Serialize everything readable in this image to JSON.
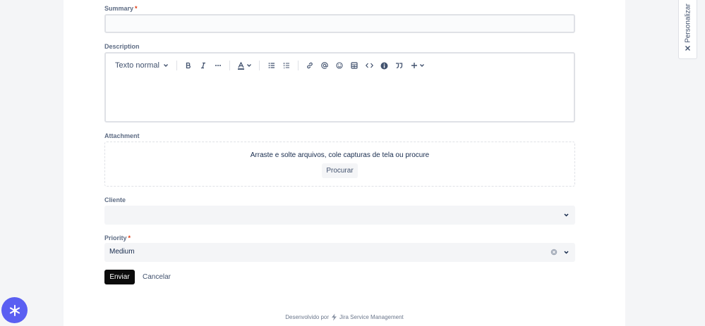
{
  "form": {
    "summary": {
      "label": "Summary",
      "required_mark": "*",
      "value": ""
    },
    "description": {
      "label": "Description",
      "toolbar": {
        "text_style": "Texto normal",
        "buttons": [
          "bold-icon",
          "italic-icon",
          "more-icon",
          "text-color-icon",
          "bullet-list-icon",
          "numbered-list-icon",
          "link-icon",
          "mention-icon",
          "emoji-icon",
          "table-icon",
          "code-icon",
          "info-icon",
          "quote-icon",
          "insert-plus-icon"
        ]
      },
      "value": ""
    },
    "attachment": {
      "label": "Attachment",
      "drop_text": "Arraste e solte arquivos, cole capturas de tela ou procure",
      "browse_label": "Procurar"
    },
    "cliente": {
      "label": "Cliente",
      "value": ""
    },
    "priority": {
      "label": "Priority",
      "required_mark": "*",
      "value": "Medium"
    },
    "submit_label": "Enviar",
    "cancel_label": "Cancelar"
  },
  "footer": {
    "prefix": "Desenvolvido por",
    "brand": "Jira Service Management"
  },
  "side_tab": {
    "label": "Personalizar"
  },
  "colors": {
    "accent_fab": "#5a5ff2",
    "required": "#de350b",
    "submit_bg": "#0b0b0b"
  }
}
